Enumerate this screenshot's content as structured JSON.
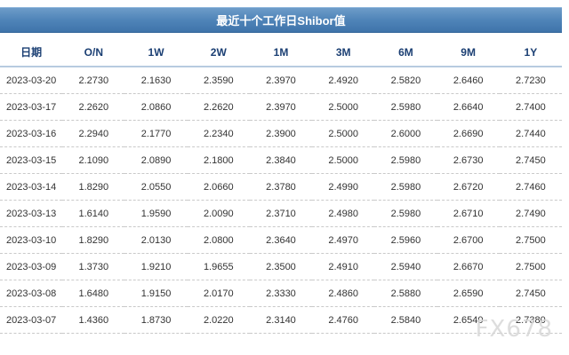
{
  "title": "最近十个工作日Shibor值",
  "columns": [
    "日期",
    "O/N",
    "1W",
    "2W",
    "1M",
    "3M",
    "6M",
    "9M",
    "1Y"
  ],
  "rows": [
    [
      "2023-03-20",
      "2.2730",
      "2.1630",
      "2.3590",
      "2.3970",
      "2.4920",
      "2.5820",
      "2.6460",
      "2.7230"
    ],
    [
      "2023-03-17",
      "2.2620",
      "2.0860",
      "2.2620",
      "2.3970",
      "2.5000",
      "2.5980",
      "2.6640",
      "2.7400"
    ],
    [
      "2023-03-16",
      "2.2940",
      "2.1770",
      "2.2340",
      "2.3900",
      "2.5000",
      "2.6000",
      "2.6690",
      "2.7440"
    ],
    [
      "2023-03-15",
      "2.1090",
      "2.0890",
      "2.1800",
      "2.3840",
      "2.5000",
      "2.5980",
      "2.6730",
      "2.7450"
    ],
    [
      "2023-03-14",
      "1.8290",
      "2.0550",
      "2.0660",
      "2.3780",
      "2.4990",
      "2.5980",
      "2.6720",
      "2.7460"
    ],
    [
      "2023-03-13",
      "1.6140",
      "1.9590",
      "2.0090",
      "2.3710",
      "2.4980",
      "2.5980",
      "2.6710",
      "2.7490"
    ],
    [
      "2023-03-10",
      "1.8290",
      "2.0130",
      "2.0800",
      "2.3640",
      "2.4970",
      "2.5960",
      "2.6700",
      "2.7500"
    ],
    [
      "2023-03-09",
      "1.3730",
      "1.9210",
      "1.9655",
      "2.3500",
      "2.4910",
      "2.5940",
      "2.6670",
      "2.7500"
    ],
    [
      "2023-03-08",
      "1.6480",
      "1.9150",
      "2.0170",
      "2.3330",
      "2.4860",
      "2.5880",
      "2.6590",
      "2.7450"
    ],
    [
      "2023-03-07",
      "1.4360",
      "1.8730",
      "2.0220",
      "2.3140",
      "2.4760",
      "2.5840",
      "2.6540",
      "2.7380"
    ]
  ],
  "watermark": "FX678",
  "colors": {
    "title_bar": "#4f84b8",
    "header_text": "#1b3f73",
    "cell_text": "#333333",
    "watermark": "#d7d7d7"
  }
}
